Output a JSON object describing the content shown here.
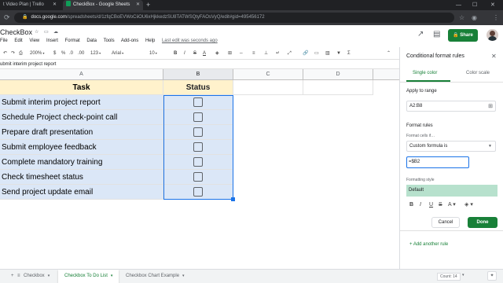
{
  "browser": {
    "tabs": [
      {
        "title": "t Video Plan | Trello",
        "close": "✕"
      },
      {
        "title": "CheckBox - Google Sheets",
        "close": "✕"
      }
    ],
    "new_tab": "+",
    "url_host": "docs.google.com",
    "url_path": "/spreadsheets/d/1zfqCBoEVWoCiiOU6xHjkkedzSU8TATWSQtyFAOsVyQ/edit#gid=495456172"
  },
  "app": {
    "doc_title": "CheckBox",
    "menus": [
      "File",
      "Edit",
      "View",
      "Insert",
      "Format",
      "Data",
      "Tools",
      "Add-ons",
      "Help"
    ],
    "last_edit": "Last edit was seconds ago",
    "share_label": "Share",
    "accent": "#188038"
  },
  "toolbar": {
    "zoom": "200%",
    "currency": "$",
    "percent": "%",
    "decimals_less": ".0",
    "decimals_more": ".00",
    "number_format": "123",
    "font": "Arial",
    "font_size": "10"
  },
  "formula_bar": {
    "content": "ubmit interim project report"
  },
  "grid": {
    "columns": [
      "A",
      "B",
      "C",
      "D"
    ],
    "header": {
      "task": "Task",
      "status": "Status"
    },
    "rows": [
      {
        "task": "Submit interim project report"
      },
      {
        "task": "Schedule Project check-point call"
      },
      {
        "task": "Prepare draft presentation"
      },
      {
        "task": "Submit employee feedback"
      },
      {
        "task": "Complete mandatory training"
      },
      {
        "task": "Check timesheet status"
      },
      {
        "task": "Send project update email"
      }
    ]
  },
  "sidebar": {
    "title": "Conditional format rules",
    "tabs": [
      "Single color",
      "Color scale"
    ],
    "apply_label": "Apply to range",
    "range": "A2:B8",
    "rules_label": "Format rules",
    "cells_if_label": "Format cells if…",
    "condition": "Custom formula is",
    "formula": "=$B2",
    "style_label": "Formatting style",
    "style_preview": "Default",
    "cancel": "Cancel",
    "done": "Done",
    "add_rule": "Add another rule"
  },
  "sheets": {
    "tabs": [
      "Checkbox",
      "Checkbox To Do List",
      "Checkbox Chart Example"
    ],
    "active_index": 1,
    "count": "Count: 14"
  }
}
